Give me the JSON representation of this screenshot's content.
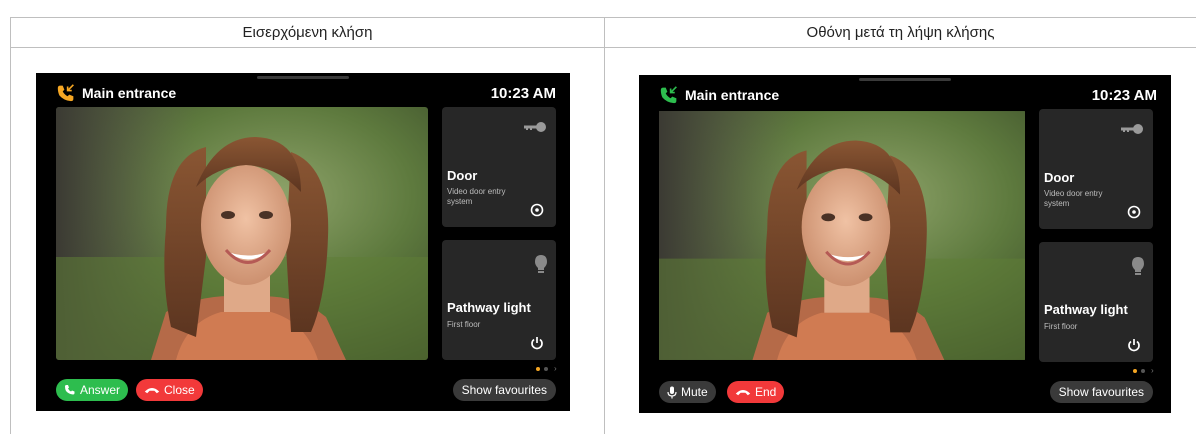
{
  "columns": [
    {
      "header": "Εισερχόμενη κλήση",
      "screen": {
        "location": "Main entrance",
        "time": "10:23 AM",
        "cards": [
          {
            "title": "Door",
            "subtitle": "Video door entry system",
            "top_icon": "key-icon",
            "bottom_icon": "target-button-icon"
          },
          {
            "title": "Pathway light",
            "subtitle": "First floor",
            "top_icon": "bulb-icon",
            "bottom_icon": "power-icon"
          }
        ],
        "actions": [
          {
            "label": "Answer",
            "icon": "phone-icon",
            "color": "#2dbd4e"
          },
          {
            "label": "Close",
            "icon": "hangup-icon",
            "color": "#f2393a"
          }
        ],
        "favourites_label": "Show favourites"
      }
    },
    {
      "header": "Οθόνη μετά τη λήψη κλήσης",
      "screen": {
        "location": "Main entrance",
        "time": "10:23 AM",
        "cards": [
          {
            "title": "Door",
            "subtitle": "Video door entry system",
            "top_icon": "key-icon",
            "bottom_icon": "target-button-icon"
          },
          {
            "title": "Pathway light",
            "subtitle": "First floor",
            "top_icon": "bulb-icon",
            "bottom_icon": "power-icon"
          }
        ],
        "actions": [
          {
            "label": "Mute",
            "icon": "microphone-icon",
            "color": "#3a3a3a"
          },
          {
            "label": "End",
            "icon": "hangup-icon",
            "color": "#f2393a"
          }
        ],
        "favourites_label": "Show favourites"
      }
    }
  ],
  "colors": {
    "accent": "#f5a623",
    "answer": "#2dbd4e",
    "decline": "#f2393a"
  }
}
